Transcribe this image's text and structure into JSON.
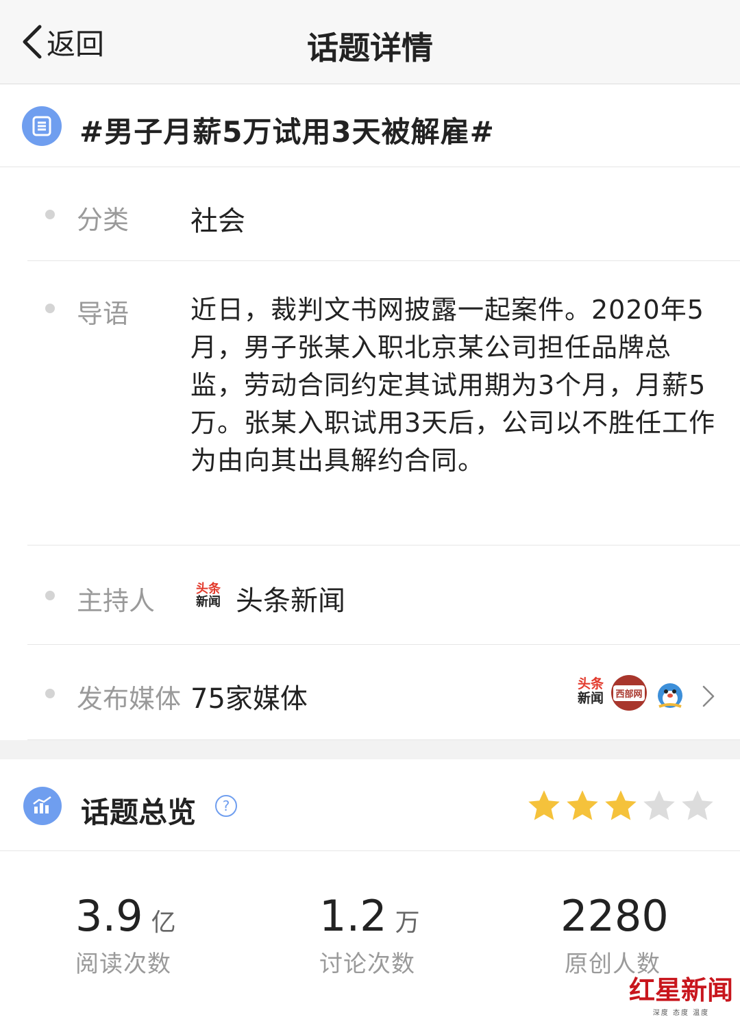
{
  "nav": {
    "back_label": "返回",
    "title": "话题详情"
  },
  "topic": {
    "title": "#男子月薪5万试用3天被解雇#"
  },
  "info": {
    "category_label": "分类",
    "category_value": "社会",
    "intro_label": "导语",
    "intro_text": "近日，裁判文书网披露一起案件。2020年5月，男子张某入职北京某公司担任品牌总监，劳动合同约定其试用期为3个月，月薪5万。张某入职试用3天后，公司以不胜任工作为由向其出具解约合同。",
    "host_label": "主持人",
    "host_logo_line1": "头条",
    "host_logo_line2": "新闻",
    "host_name": "头条新闻",
    "media_label": "发布媒体",
    "media_value": "75家媒体",
    "media_logo_toutiao_l1": "头条",
    "media_logo_toutiao_l2": "新闻",
    "media_logo_xibu": "西部网"
  },
  "overview": {
    "title": "话题总览",
    "help_glyph": "?",
    "rating": 3,
    "rating_max": 5,
    "star_color_active": "#f5c23b",
    "star_color_inactive": "#dcdcdc"
  },
  "stats": [
    {
      "value": "3.9",
      "unit": "亿",
      "label": "阅读次数"
    },
    {
      "value": "1.2",
      "unit": "万",
      "label": "讨论次数"
    },
    {
      "value": "2280",
      "unit": "",
      "label": "原创人数"
    }
  ],
  "watermark": {
    "main": "红星新闻",
    "sub": "深度 态度 温度"
  },
  "colors": {
    "accent_blue": "#6f9eef",
    "brand_red": "#c8161d"
  },
  "icons": {
    "back": "chevron-left-icon",
    "topic": "list-icon",
    "overview": "bar-chart-icon",
    "help": "question-icon",
    "more": "chevron-right-icon"
  }
}
